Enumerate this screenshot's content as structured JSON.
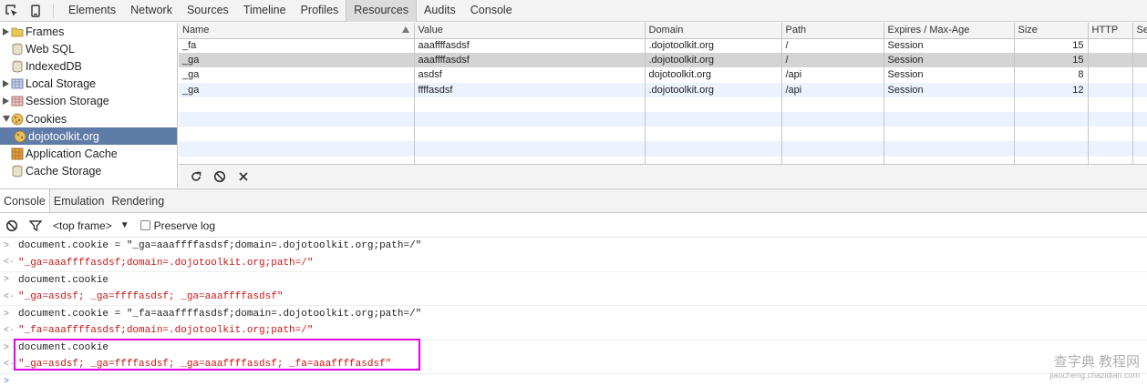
{
  "toolbar": {
    "tabs": [
      "Elements",
      "Network",
      "Sources",
      "Timeline",
      "Profiles",
      "Resources",
      "Audits",
      "Console"
    ],
    "active_tab": "Resources"
  },
  "sidebar": {
    "items": [
      {
        "label": "Frames",
        "icon": "folder-icon"
      },
      {
        "label": "Web SQL",
        "icon": "database-icon"
      },
      {
        "label": "IndexedDB",
        "icon": "database-icon"
      },
      {
        "label": "Local Storage",
        "icon": "table-icon"
      },
      {
        "label": "Session Storage",
        "icon": "table-icon"
      },
      {
        "label": "Cookies",
        "icon": "cookie-icon"
      },
      {
        "label": "dojotoolkit.org",
        "icon": "cookie-icon"
      },
      {
        "label": "Application Cache",
        "icon": "grid-icon"
      },
      {
        "label": "Cache Storage",
        "icon": "database-icon"
      }
    ]
  },
  "cookies": {
    "columns": [
      "Name",
      "Value",
      "Domain",
      "Path",
      "Expires / Max-Age",
      "Size",
      "HTTP",
      "Se"
    ],
    "rows": [
      [
        "_fa",
        "aaaffffasdsf",
        ".dojotoolkit.org",
        "/",
        "Session",
        "15",
        "",
        ""
      ],
      [
        "_ga",
        "aaaffffasdsf",
        ".dojotoolkit.org",
        "/",
        "Session",
        "15",
        "",
        ""
      ],
      [
        "_ga",
        "asdsf",
        "dojotoolkit.org",
        "/api",
        "Session",
        "8",
        "",
        ""
      ],
      [
        "_ga",
        "ffffasdsf",
        ".dojotoolkit.org",
        "/api",
        "Session",
        "12",
        "",
        ""
      ]
    ]
  },
  "drawer": {
    "tabs": [
      "Console",
      "Emulation",
      "Rendering"
    ],
    "frame": "<top frame>",
    "preserve_log": "Preserve log"
  },
  "console": {
    "lines": [
      {
        "kind": "in",
        "text": "document.cookie = \"_ga=aaaffffasdsf;domain=.dojotoolkit.org;path=/\""
      },
      {
        "kind": "out",
        "text": "\"_ga=aaaffffasdsf;domain=.dojotoolkit.org;path=/\""
      },
      {
        "kind": "in",
        "text": "document.cookie"
      },
      {
        "kind": "out",
        "text": "\"_ga=asdsf; _ga=ffffasdsf; _ga=aaaffffasdsf\""
      },
      {
        "kind": "in",
        "text": "document.cookie = \"_fa=aaaffffasdsf;domain=.dojotoolkit.org;path=/\""
      },
      {
        "kind": "out",
        "text": "\"_fa=aaaffffasdsf;domain=.dojotoolkit.org;path=/\""
      },
      {
        "kind": "in",
        "text": "document.cookie"
      },
      {
        "kind": "out",
        "text": "\"_ga=asdsf; _ga=ffffasdsf; _ga=aaaffffasdsf; _fa=aaaffffasdsf\""
      }
    ]
  },
  "colors": {
    "highlight": "#e600e6",
    "result_string": "#c41a16",
    "selected_sidebar": "#5f7ba7"
  },
  "watermark": {
    "main": "查字典 教程网",
    "sub": "jiaocheng.chazidian.com"
  }
}
